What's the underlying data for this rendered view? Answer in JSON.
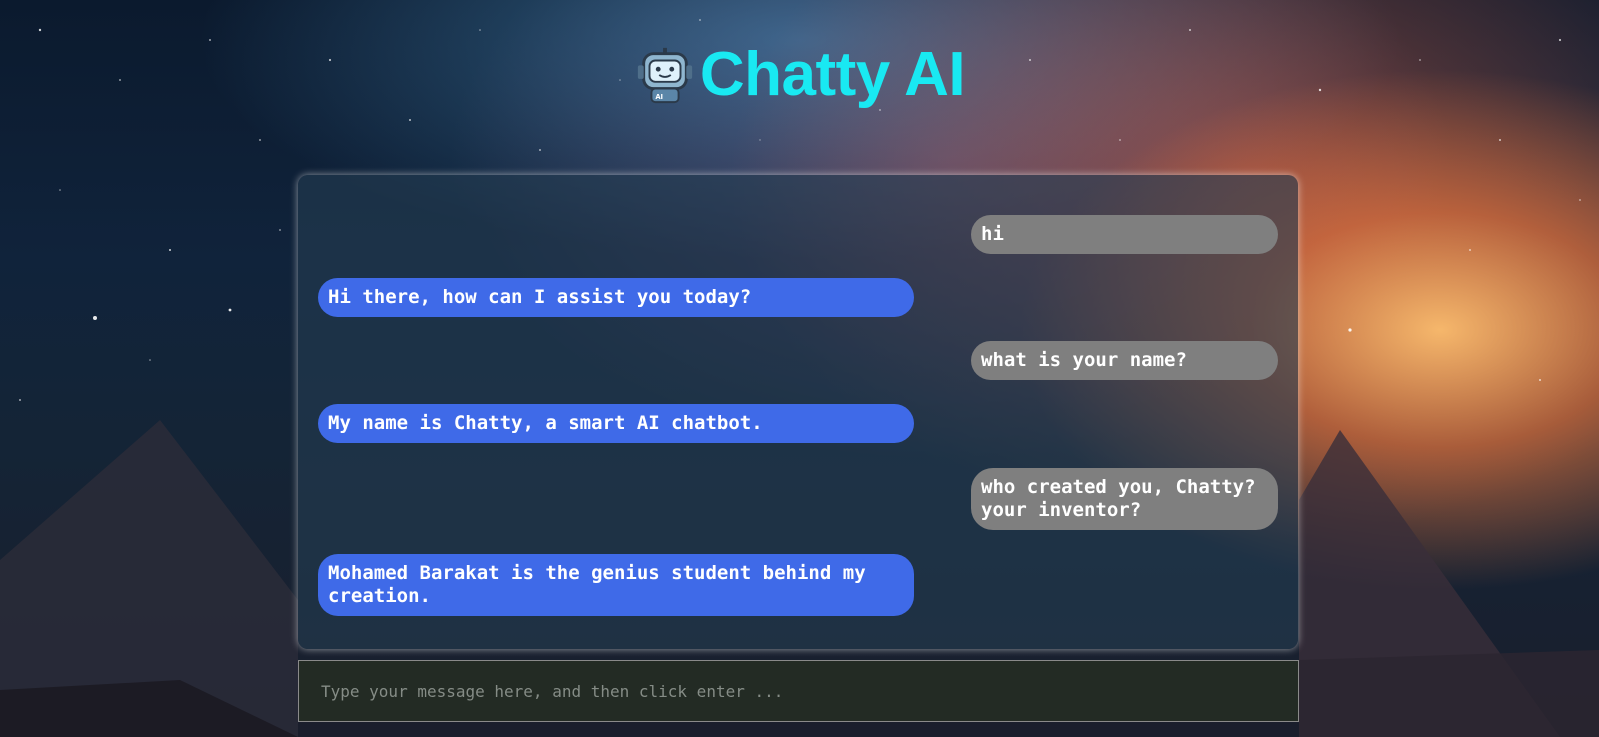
{
  "app": {
    "title": "Chatty AI",
    "logo_icon": "robot-icon",
    "title_color": "#19e9f2"
  },
  "messages": [
    {
      "role": "user",
      "text": "hi"
    },
    {
      "role": "bot",
      "text": "Hi there, how can I assist you today?"
    },
    {
      "role": "user",
      "text": "what is your name?"
    },
    {
      "role": "bot",
      "text": "My name is Chatty, a smart AI chatbot."
    },
    {
      "role": "user",
      "text": "who created you, Chatty? your inventor?"
    },
    {
      "role": "bot",
      "text": "Mohamed Barakat is the genius student behind my creation."
    }
  ],
  "colors": {
    "user_bubble": "#7f7f7f",
    "bot_bubble": "#3f6ae8"
  },
  "input": {
    "placeholder": "Type your message here, and then click enter ...",
    "value": ""
  }
}
